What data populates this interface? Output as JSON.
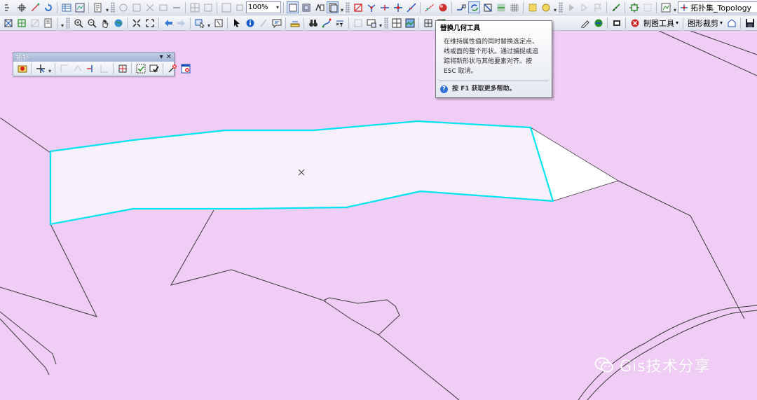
{
  "toolbar": {
    "zoom_value": "100%",
    "topology_combo_value": "拓扑集_Topology",
    "menus": {
      "cartography_tools": "制图工具",
      "graphic_clip": "图形裁剪"
    }
  },
  "topology_toolbar": {
    "title": "拓扑",
    "dropdown_glyph": "▾",
    "close_glyph": "✕"
  },
  "tooltip": {
    "title": "替换几何工具",
    "body_lines": [
      "在维持属性值的同时替换选定点、",
      "线或面的整个形状。通过捕捉或追",
      "踪将新形状与其他要素对齐。按",
      "ESC 取消。"
    ],
    "help": "按 F1 获取更多帮助。"
  },
  "watermark": {
    "text": "Gis技术分享"
  },
  "colors": {
    "map_background": "#f0cdf5",
    "selected_outline": "#00e5f0",
    "selected_fill": "#f8f0fa",
    "white_polygon": "#ffffff",
    "boundary_line": "#3a3a3a"
  }
}
